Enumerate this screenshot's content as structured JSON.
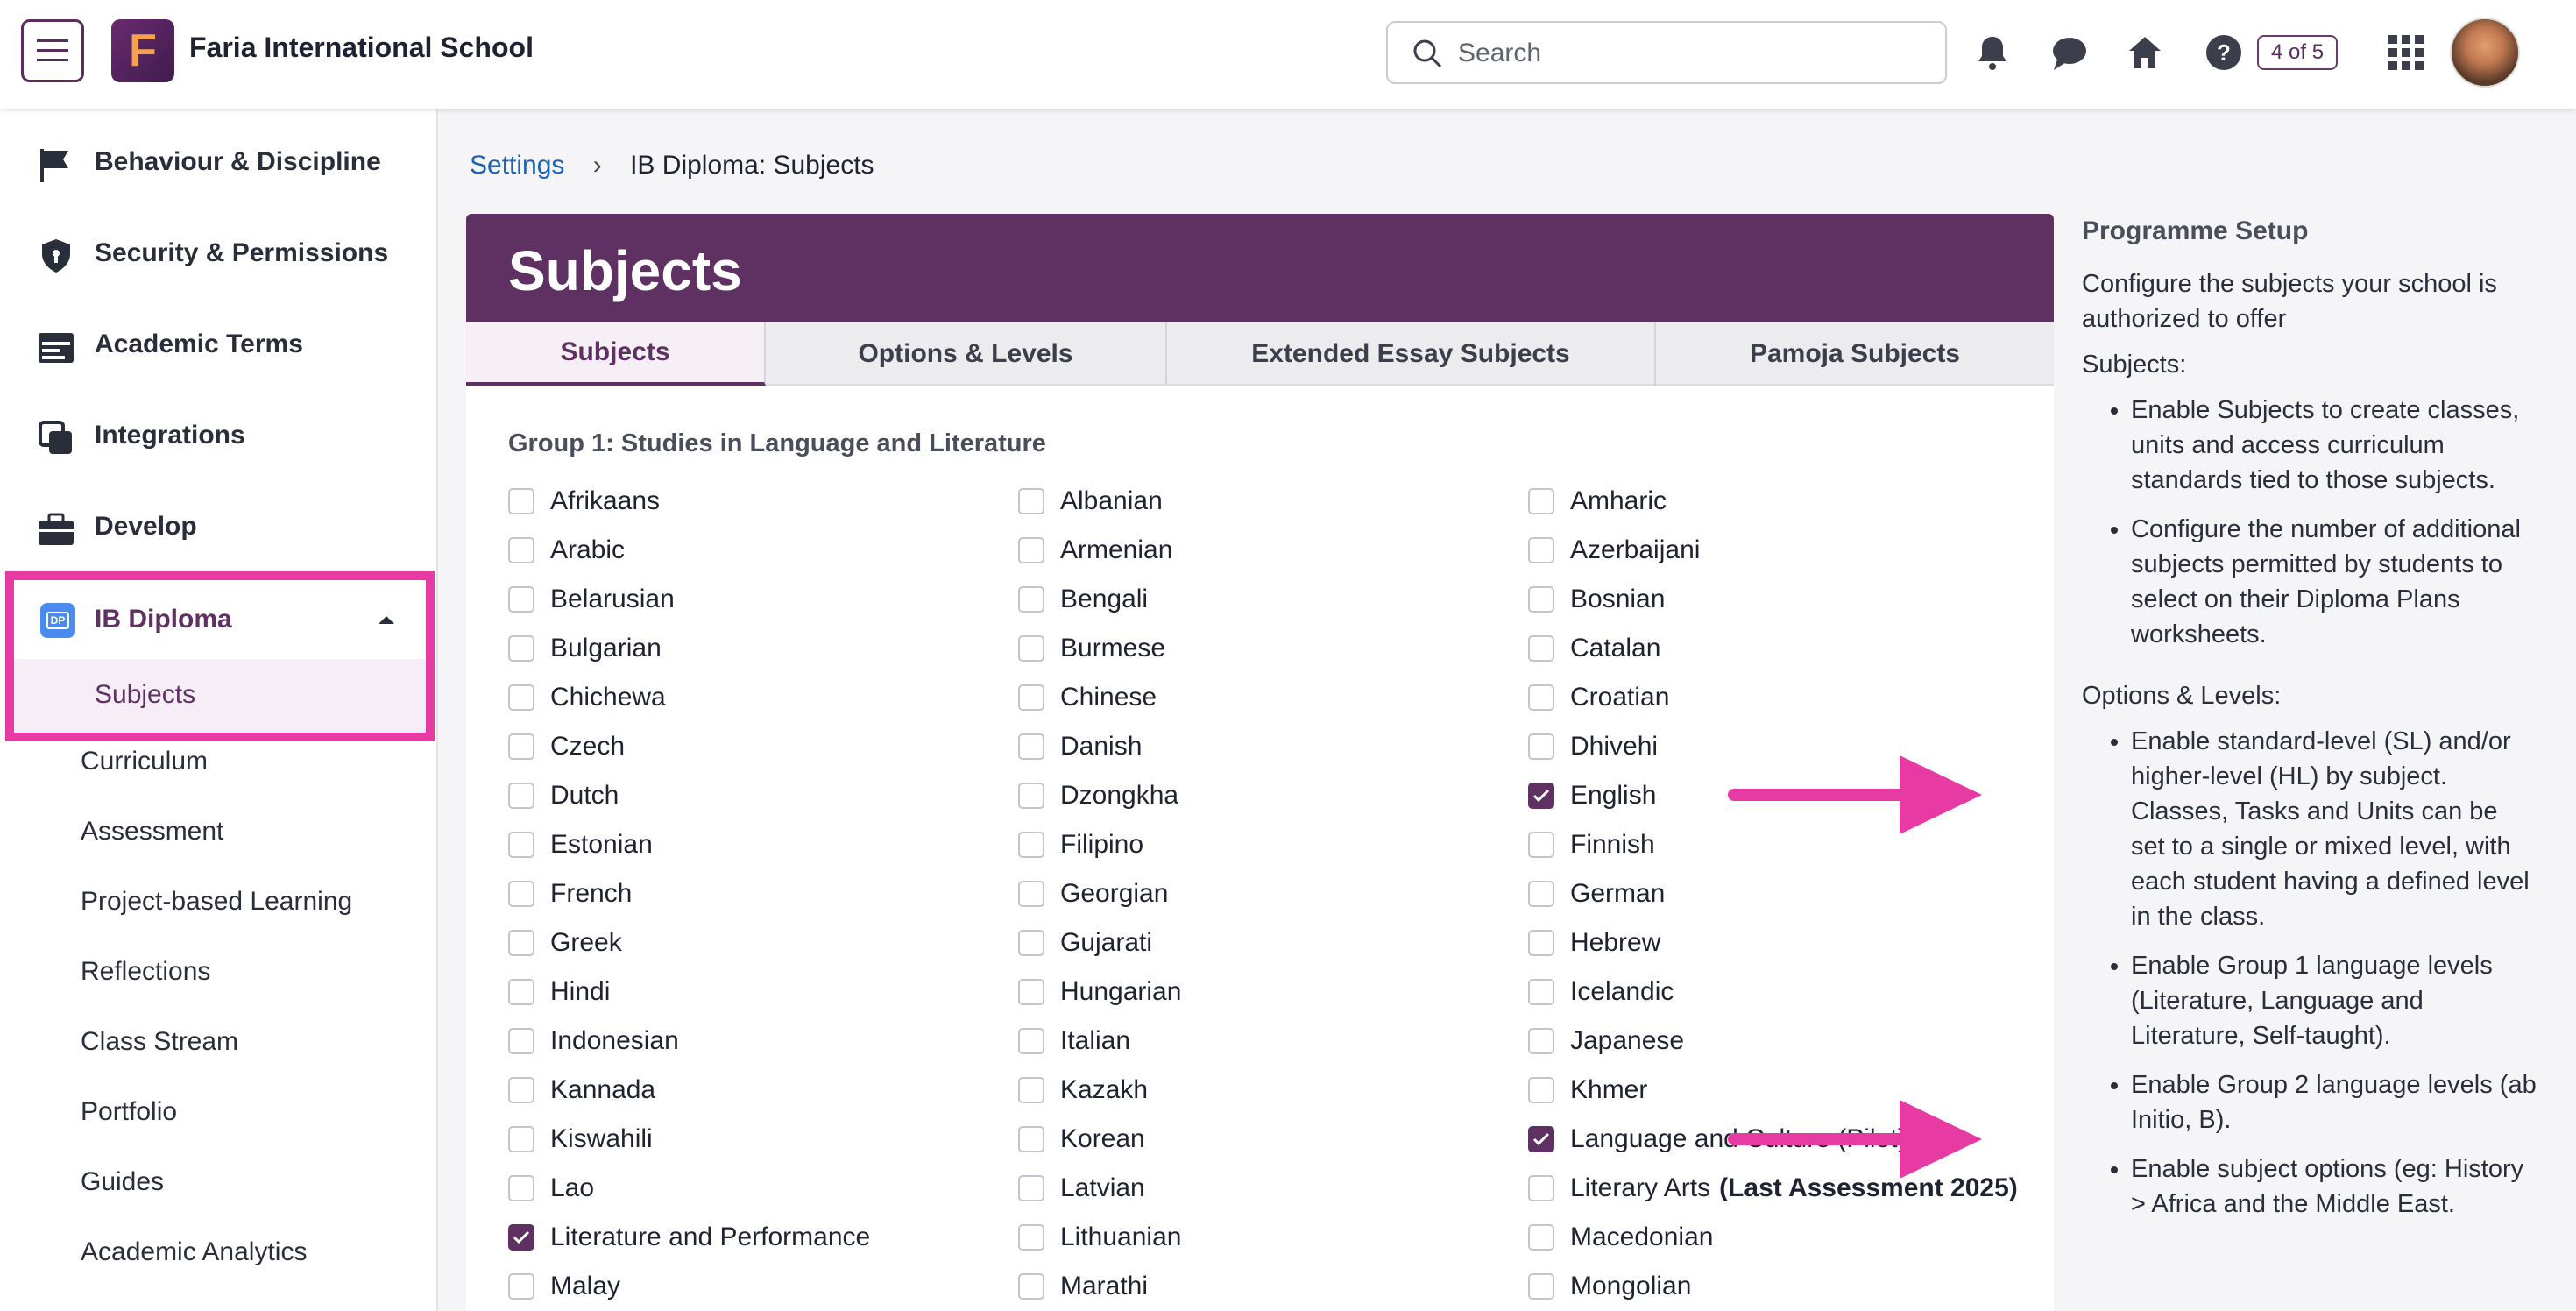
{
  "topbar": {
    "school_name": "Faria International School",
    "logo_letter": "F",
    "search_placeholder": "Search",
    "tour_count": "4 of 5",
    "icons": [
      "menu-icon",
      "search-icon",
      "bell-icon",
      "chat-icon",
      "home-icon",
      "help-icon",
      "apps-grid-icon",
      "avatar"
    ]
  },
  "sidebar": {
    "items": [
      {
        "label": "Behaviour & Discipline",
        "icon": "flag-icon"
      },
      {
        "label": "Security & Permissions",
        "icon": "shield-icon"
      },
      {
        "label": "Academic Terms",
        "icon": "calendar-icon"
      },
      {
        "label": "Integrations",
        "icon": "integrations-icon"
      },
      {
        "label": "Develop",
        "icon": "briefcase-icon"
      }
    ],
    "ib_diploma": {
      "label": "IB Diploma",
      "icon": "dp-icon",
      "badge": "DP"
    },
    "sub_items": [
      "Subjects",
      "Curriculum",
      "Assessment",
      "Project-based Learning",
      "Reflections",
      "Class Stream",
      "Portfolio",
      "Guides",
      "Academic Analytics"
    ]
  },
  "breadcrumb": {
    "root": "Settings",
    "current": "IB Diploma: Subjects"
  },
  "panel": {
    "title": "Subjects",
    "tabs": [
      "Subjects",
      "Options & Levels",
      "Extended Essay Subjects",
      "Pamoja Subjects"
    ],
    "active_tab": "Subjects",
    "group_title": "Group 1: Studies in Language and Literature",
    "columns": [
      [
        {
          "label": "Afrikaans",
          "checked": false
        },
        {
          "label": "Arabic",
          "checked": false
        },
        {
          "label": "Belarusian",
          "checked": false
        },
        {
          "label": "Bulgarian",
          "checked": false
        },
        {
          "label": "Chichewa",
          "checked": false
        },
        {
          "label": "Czech",
          "checked": false
        },
        {
          "label": "Dutch",
          "checked": false
        },
        {
          "label": "Estonian",
          "checked": false
        },
        {
          "label": "French",
          "checked": false
        },
        {
          "label": "Greek",
          "checked": false
        },
        {
          "label": "Hindi",
          "checked": false
        },
        {
          "label": "Indonesian",
          "checked": false
        },
        {
          "label": "Kannada",
          "checked": false
        },
        {
          "label": "Kiswahili",
          "checked": false
        },
        {
          "label": "Lao",
          "checked": false
        },
        {
          "label": "Literature and Performance",
          "checked": true
        },
        {
          "label": "Malay",
          "checked": false
        }
      ],
      [
        {
          "label": "Albanian",
          "checked": false
        },
        {
          "label": "Armenian",
          "checked": false
        },
        {
          "label": "Bengali",
          "checked": false
        },
        {
          "label": "Burmese",
          "checked": false
        },
        {
          "label": "Chinese",
          "checked": false
        },
        {
          "label": "Danish",
          "checked": false
        },
        {
          "label": "Dzongkha",
          "checked": false
        },
        {
          "label": "Filipino",
          "checked": false
        },
        {
          "label": "Georgian",
          "checked": false
        },
        {
          "label": "Gujarati",
          "checked": false
        },
        {
          "label": "Hungarian",
          "checked": false
        },
        {
          "label": "Italian",
          "checked": false
        },
        {
          "label": "Kazakh",
          "checked": false
        },
        {
          "label": "Korean",
          "checked": false
        },
        {
          "label": "Latvian",
          "checked": false
        },
        {
          "label": "Lithuanian",
          "checked": false
        },
        {
          "label": "Marathi",
          "checked": false
        }
      ],
      [
        {
          "label": "Amharic",
          "checked": false
        },
        {
          "label": "Azerbaijani",
          "checked": false
        },
        {
          "label": "Bosnian",
          "checked": false
        },
        {
          "label": "Catalan",
          "checked": false
        },
        {
          "label": "Croatian",
          "checked": false
        },
        {
          "label": "Dhivehi",
          "checked": false
        },
        {
          "label": "English",
          "checked": true
        },
        {
          "label": "Finnish",
          "checked": false
        },
        {
          "label": "German",
          "checked": false
        },
        {
          "label": "Hebrew",
          "checked": false
        },
        {
          "label": "Icelandic",
          "checked": false
        },
        {
          "label": "Japanese",
          "checked": false
        },
        {
          "label": "Khmer",
          "checked": false
        },
        {
          "label": "Language and Culture (Pilot)",
          "checked": true
        },
        {
          "label": "Literary Arts",
          "bold_suffix": "(Last Assessment 2025)",
          "checked": false
        },
        {
          "label": "Macedonian",
          "checked": false
        },
        {
          "label": "Mongolian",
          "checked": false
        }
      ]
    ]
  },
  "help": {
    "title": "Programme Setup",
    "intro": "Configure the subjects your school is authorized to offer",
    "subjects_heading": "Subjects:",
    "subjects_points": [
      "Enable Subjects to create classes, units and access curriculum standards tied to those subjects.",
      "Configure the number of additional subjects permitted by students to select on their Diploma Plans worksheets."
    ],
    "options_heading": "Options & Levels:",
    "options_points": [
      "Enable standard-level (SL) and/or higher-level (HL) by subject. Classes, Tasks and Units can be set to a single or mixed level, with each student having a defined level in the class.",
      "Enable Group 1 language levels (Literature, Language and Literature, Self-taught).",
      "Enable Group 2 language levels (ab Initio, B).",
      "Enable subject options (eg: History > Africa and the Middle East."
    ]
  },
  "colors": {
    "accent": "#5e3162",
    "highlight": "#e83aa3",
    "link": "#1a64b8"
  }
}
